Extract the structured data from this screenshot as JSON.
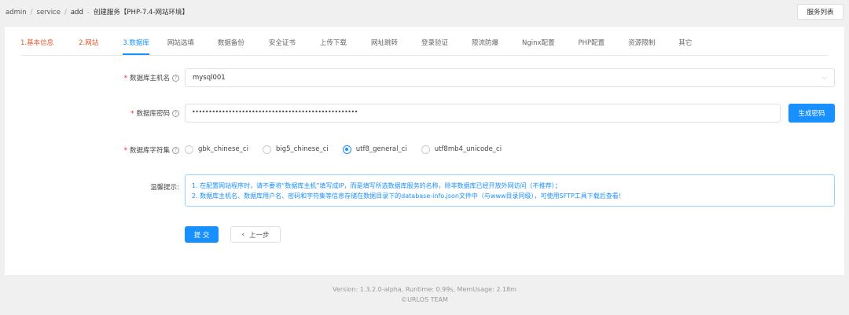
{
  "breadcrumb": {
    "items": [
      "admin",
      "service",
      "add"
    ],
    "current": "创建服务【PHP-7.4-网站环境】"
  },
  "header": {
    "list_button": "服务列表"
  },
  "tabs": [
    {
      "label": "1.基本信息",
      "state": "done"
    },
    {
      "label": "2.网站",
      "state": "done"
    },
    {
      "label": "3.数据库",
      "state": "active"
    },
    {
      "label": "网站选填",
      "state": ""
    },
    {
      "label": "数据备份",
      "state": ""
    },
    {
      "label": "安全证书",
      "state": ""
    },
    {
      "label": "上传下载",
      "state": ""
    },
    {
      "label": "网址跳转",
      "state": ""
    },
    {
      "label": "登录验证",
      "state": ""
    },
    {
      "label": "限流防爆",
      "state": ""
    },
    {
      "label": "Nginx配置",
      "state": ""
    },
    {
      "label": "PHP配置",
      "state": ""
    },
    {
      "label": "资源限制",
      "state": ""
    },
    {
      "label": "其它",
      "state": ""
    }
  ],
  "form": {
    "required_mark": "*",
    "help_glyph": "?",
    "host": {
      "label": "数据库主机名",
      "value": "mysql001"
    },
    "password": {
      "label": "数据库密码",
      "value": "••••••••••••••••••••••••••••••••••••••••••••••••••",
      "generate_label": "生成密码"
    },
    "charset": {
      "label": "数据库字符集",
      "options": [
        "gbk_chinese_ci",
        "big5_chinese_ci",
        "utf8_general_ci",
        "utf8mb4_unicode_ci"
      ],
      "selected": "utf8_general_ci"
    },
    "tips": {
      "label": "温馨提示:",
      "lines": [
        "1. 在配置网站程序时，请不要将“数据库主机”填写成IP，而是填写所选数据库服务的名称，除非数据库已经开放外网访问（不推荐）；",
        "2. 数据库主机名、数据库用户名、密码和字符集等信息存储在数据目录下的database-info.json文件中（与www目录同级），可使用SFTP工具下载后查看!"
      ]
    },
    "submit_label": "提 交",
    "prev_label": "上一步"
  },
  "footer": {
    "line1": "Version: 1.3.2.0-alpha,   Runtime: 0.99s,   MemUsage: 2.18m",
    "line2": "©URLOS TEAM"
  },
  "colors": {
    "accent": "#1890ff",
    "done": "#e4572e",
    "required": "#f5222d"
  }
}
